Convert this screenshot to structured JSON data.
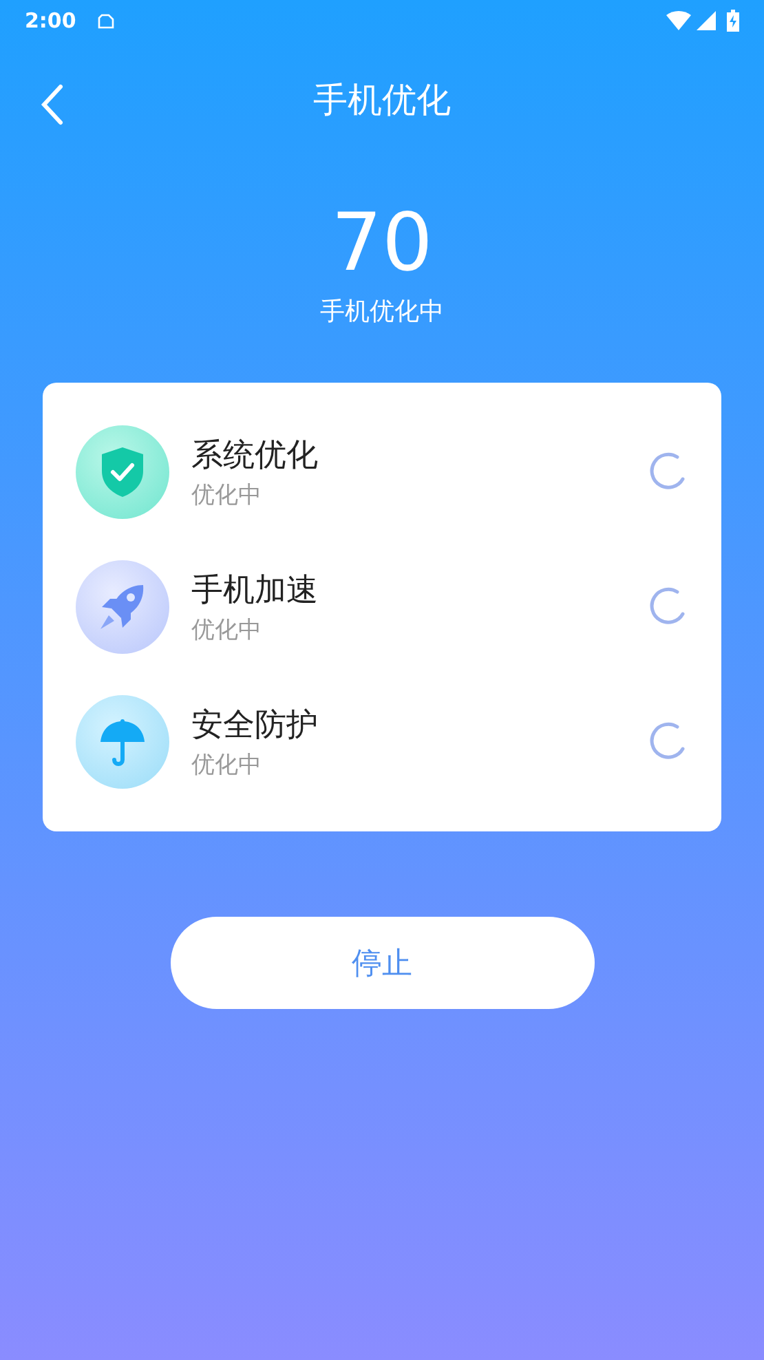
{
  "status_bar": {
    "time": "2:00"
  },
  "header": {
    "title": "手机优化"
  },
  "score": {
    "value": "70",
    "caption": "手机优化中"
  },
  "tasks": [
    {
      "kind": "shield",
      "name": "系统优化",
      "status": "优化中"
    },
    {
      "kind": "rocket",
      "name": "手机加速",
      "status": "优化中"
    },
    {
      "kind": "umbrella",
      "name": "安全防护",
      "status": "优化中"
    }
  ],
  "stop_button": {
    "label": "停止"
  }
}
